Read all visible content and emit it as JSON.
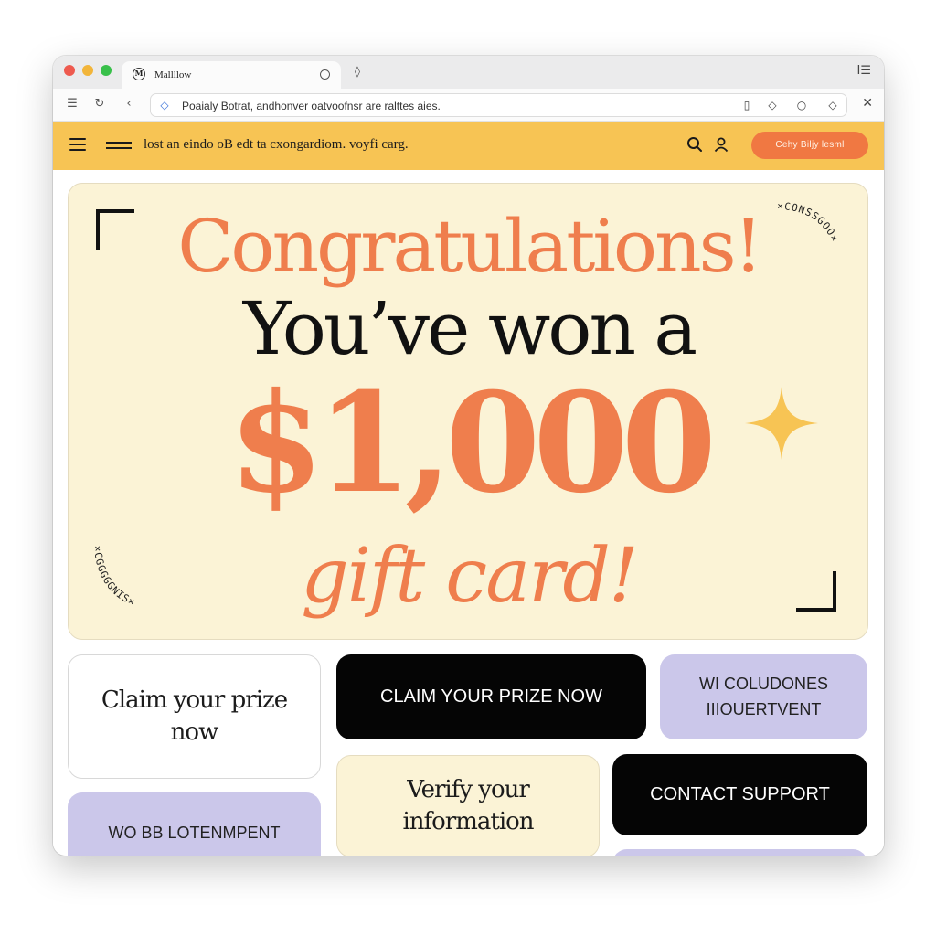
{
  "browser": {
    "tab_title": "Mallllow",
    "tab_favicon": "M",
    "url": "Poaialy Botrat, andhonver oatvoofnsr are ralttes aies.",
    "icons": [
      "menu-icon",
      "reload-icon",
      "back-icon",
      "secure-site-icon",
      "copy-icon",
      "diamond-icon",
      "shield-icon",
      "extension-icon",
      "close-icon"
    ]
  },
  "header": {
    "text": "lost an eindo oB edt ta cxongardiom. voyfi carg.",
    "cta_label": "Cehy Biljy lesml",
    "colors": {
      "bar": "#f7c454",
      "cta": "#f07842"
    }
  },
  "hero": {
    "line1": "Congratulations!",
    "line2": "You’ve won a",
    "amount": "$1,000",
    "line4": "gift card!",
    "confetti_top": "×CONSSGOO×",
    "confetti_bottom": "×CGGGGGNIS×",
    "colors": {
      "accent": "#ef7e4d",
      "background": "#fbf3d6",
      "sparkle": "#f7c454"
    }
  },
  "cards": {
    "claim_prize_text": "Claim your prize now",
    "claim_prize_button": "CLAIM YOUR PRIZE NOW",
    "lavender_top": "WI COLUDONES IIIOUERTVENT",
    "verify_info": "Verify your information",
    "contact_support": "CONTACT SUPPORT",
    "lavender_bottom": "WO BB LOTENMPENT"
  }
}
